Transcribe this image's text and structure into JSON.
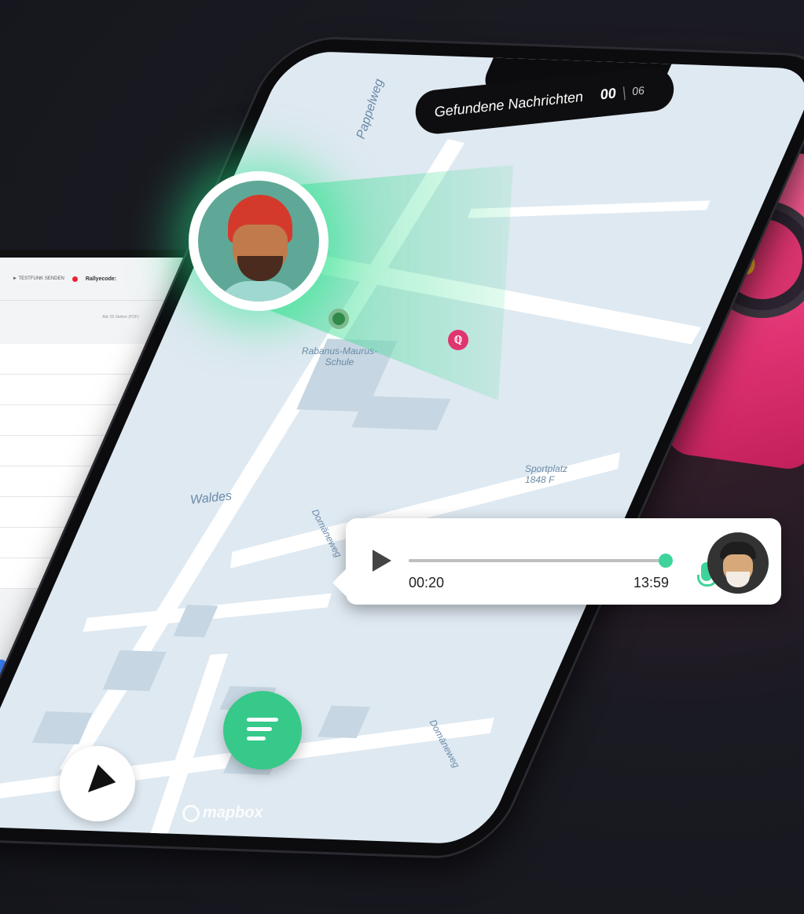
{
  "laptop": {
    "toolbar_text": "► TESTFUNK SENDEN",
    "rally_label": "Rallyecode:",
    "subbar_text": "Alle 00 Stellen (PDF)"
  },
  "header": {
    "found_label": "Gefundene Nachrichten",
    "found_count": "00",
    "found_total": "06"
  },
  "map": {
    "labels": [
      "Pappelweg",
      "Rabanus-Maurus-Schule",
      "Sportplatz 1848 F",
      "Waldes",
      "Domäneweg",
      "Domäneweg"
    ],
    "pin_pink_letter": "ℚ"
  },
  "audio": {
    "elapsed": "00:20",
    "duration": "13:59",
    "progress": 0.99,
    "accent": "#3ed39a"
  },
  "controls": {
    "menu_icon": "menu-icon",
    "nav_icon": "navigation-arrow-icon"
  },
  "branding": {
    "map_provider": "mapbox"
  }
}
